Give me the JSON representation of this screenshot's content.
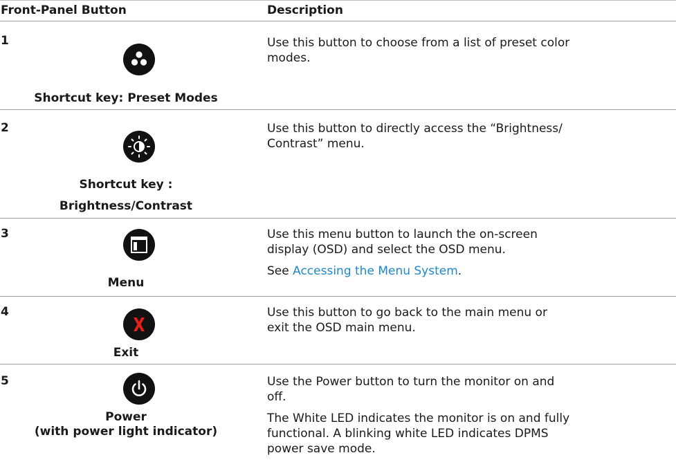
{
  "table": {
    "col_button": "Front-Panel Button",
    "col_description": "Description",
    "rows": [
      {
        "num": "1",
        "icon": "preset-modes-icon",
        "label": "Shortcut key: Preset Modes",
        "desc": "Use this button to choose from a list of preset color modes."
      },
      {
        "num": "2",
        "icon": "brightness-contrast-icon",
        "label_line1": "Shortcut key :",
        "label_line2": "Brightness/Contrast",
        "desc": "Use this button to directly access the “Brightness/ Contrast” menu."
      },
      {
        "num": "3",
        "icon": "menu-icon",
        "label": "Menu",
        "desc": "Use this menu button to launch the on-screen display (OSD) and select the OSD menu.",
        "see_prefix": "See ",
        "see_link": "Accessing the Menu System",
        "see_suffix": "."
      },
      {
        "num": "4",
        "icon": "exit-x-icon",
        "label": "Exit",
        "desc": "Use this button to go back to the main menu or exit the OSD main menu."
      },
      {
        "num": "5",
        "icon": "power-icon",
        "label_line1": "Power",
        "label_line2": "(with power light indicator)",
        "desc": "Use the Power button to turn the monitor on and off.",
        "desc2": "The White LED indicates the monitor is on and fully functional. A blinking white LED indicates DPMS power save mode."
      }
    ]
  },
  "colors": {
    "link": "#1e88c8",
    "exit_x": "#e32119",
    "button": "#111111"
  }
}
